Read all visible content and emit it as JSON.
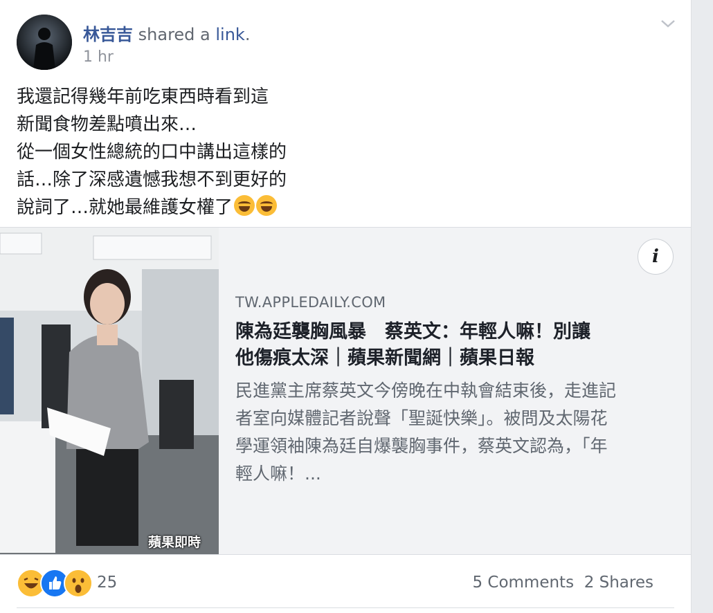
{
  "post": {
    "author": "林吉吉",
    "action_prefix": "shared a ",
    "action_link": "link",
    "action_suffix": ".",
    "time": "1 hr",
    "text_lines": [
      "我還記得幾年前吃東西時看到這",
      "新聞食物差點噴出來…",
      "從一個女性總統的口中講出這樣的",
      "話…除了深感遺憾我想不到更好的",
      "說詞了…就她最維護女權了"
    ],
    "trailing_emoji": [
      "rofl-emoji",
      "rofl-emoji"
    ]
  },
  "link_preview": {
    "domain": "TW.APPLEDAILY.COM",
    "title_lines": [
      "陳為廷襲胸風暴　蔡英文：年輕人嘛！別讓",
      "他傷痕太深｜蘋果新聞網｜蘋果日報"
    ],
    "description_lines": [
      "民進黨主席蔡英文今傍晚在中執會結束後，走進記",
      "者室向媒體記者說聲「聖誕快樂」。被問及太陽花",
      "學運領袖陳為廷自爆襲胸事件，蔡英文認為，「年",
      "輕人嘛！..."
    ],
    "image_caption": "蘋果即時",
    "info_label": "i"
  },
  "footer": {
    "reaction_icons": [
      "haha-icon",
      "like-icon",
      "wow-icon"
    ],
    "reaction_count": "25",
    "comments": "5 Comments",
    "shares": "2 Shares"
  },
  "colors": {
    "author": "#385898",
    "meta": "#616770",
    "like": "#1877f2",
    "emoji": "#fbbd37"
  }
}
